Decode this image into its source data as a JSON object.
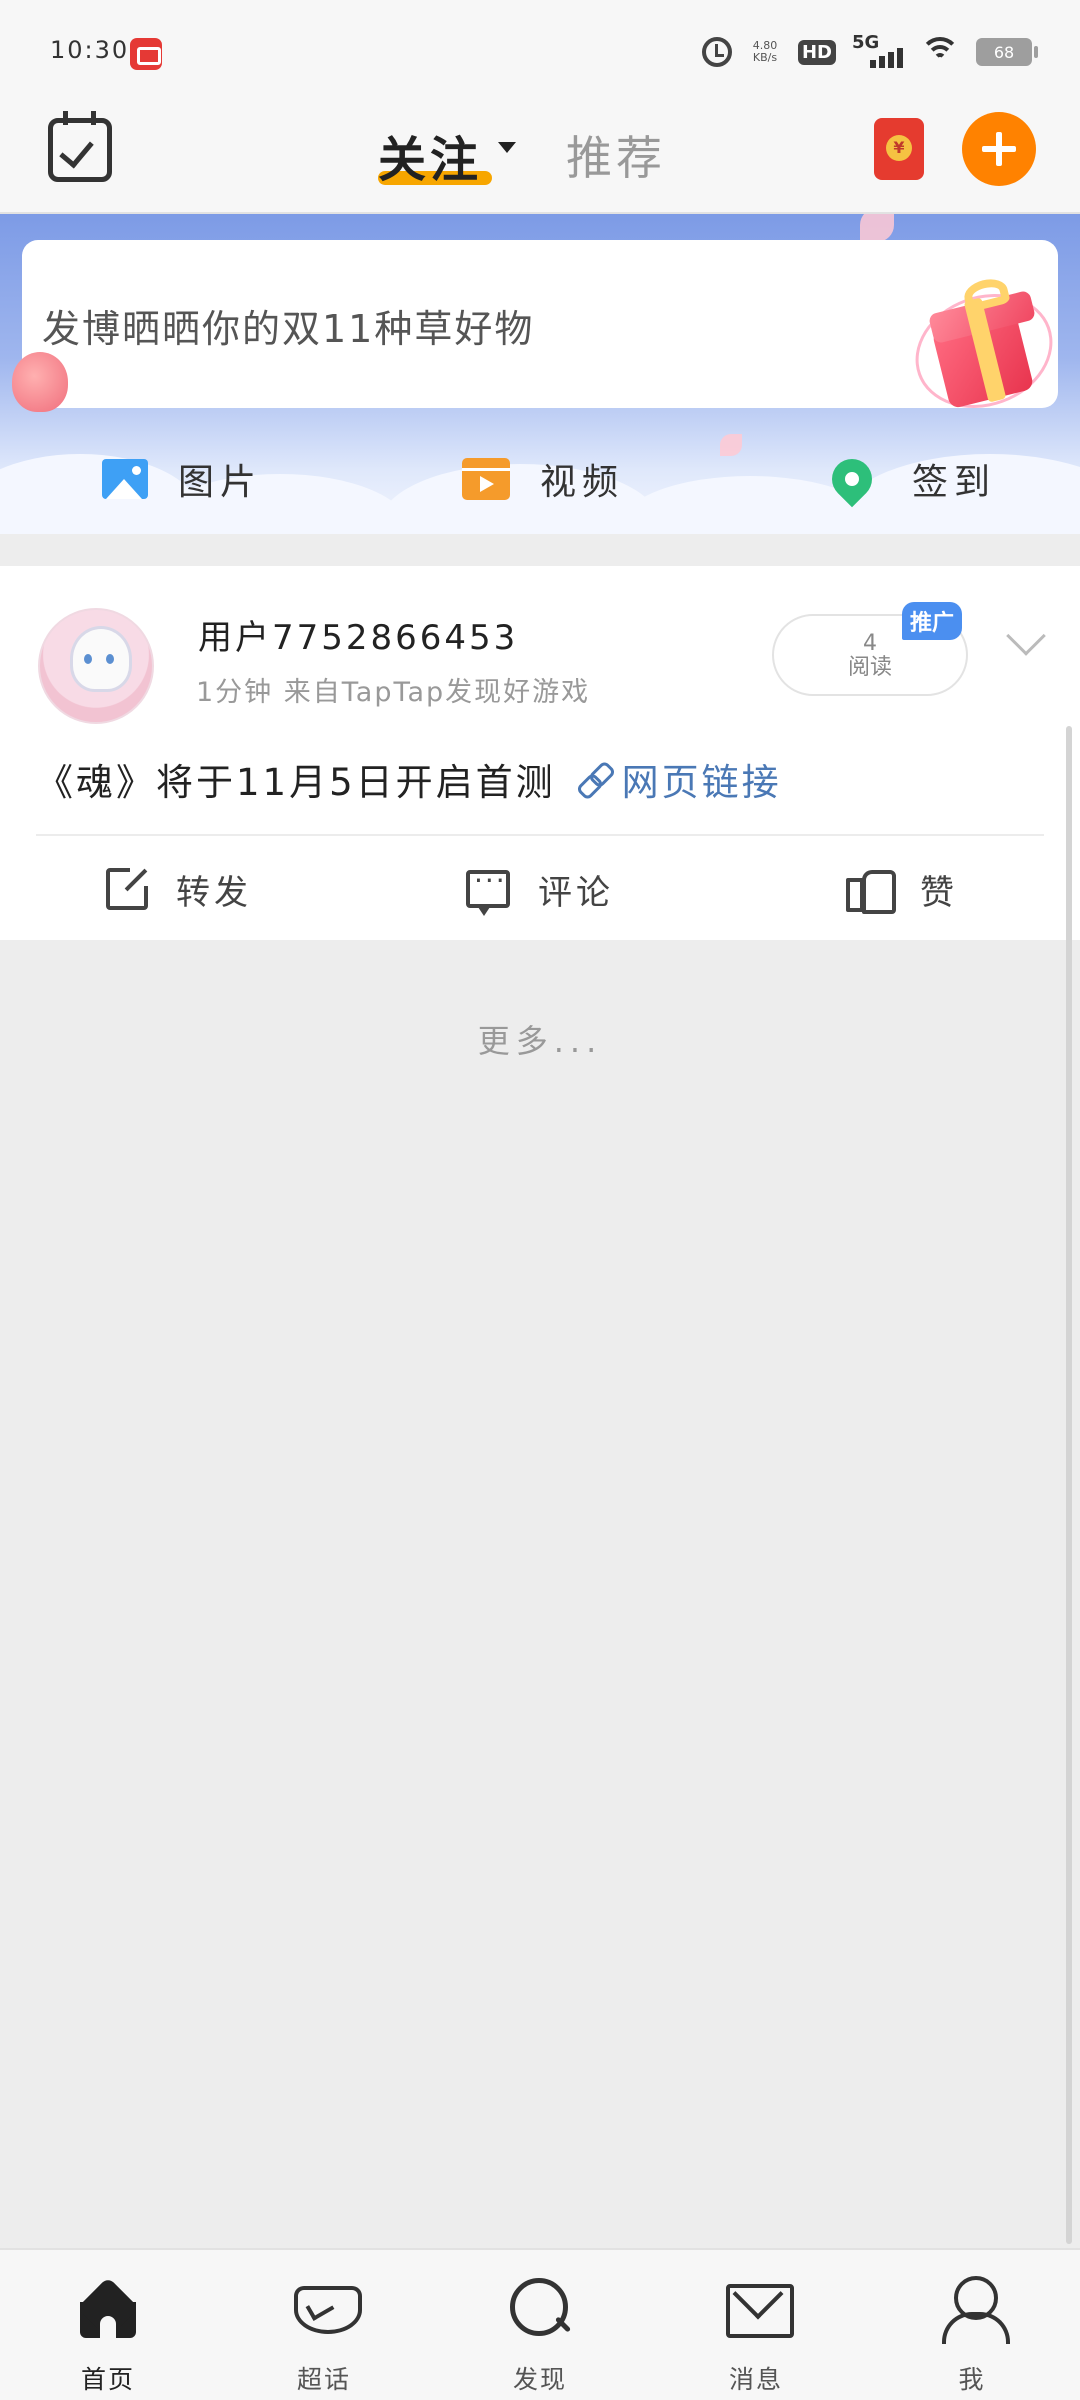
{
  "status_bar": {
    "time": "10:30",
    "net_speed_value": "4.80",
    "net_speed_unit": "KB/s",
    "hd_label": "HD",
    "network_label": "5G",
    "battery": "68"
  },
  "top_nav": {
    "tabs": [
      {
        "label": "关注",
        "active": true
      },
      {
        "label": "推荐",
        "active": false
      }
    ],
    "accent_color": "#f7a600",
    "add_button_color": "#ff8200"
  },
  "compose": {
    "placeholder": "发博晒晒你的双11种草好物",
    "actions": [
      {
        "label": "图片",
        "icon": "image-icon"
      },
      {
        "label": "视频",
        "icon": "video-icon"
      },
      {
        "label": "签到",
        "icon": "location-pin-icon"
      }
    ]
  },
  "feed": {
    "posts": [
      {
        "username": "用户7752866453",
        "meta": "1分钟  来自TapTap发现好游戏",
        "reads_count": "4",
        "reads_label": "阅读",
        "promo_badge": "推广",
        "text": "《魂》将于11月5日开启首测",
        "link_label": "网页链接",
        "actions": [
          {
            "label": "转发",
            "icon": "share-icon"
          },
          {
            "label": "评论",
            "icon": "comment-icon"
          },
          {
            "label": "赞",
            "icon": "like-icon"
          }
        ]
      }
    ],
    "more_label": "更多..."
  },
  "bottom_nav": {
    "items": [
      {
        "label": "首页",
        "icon": "home-icon",
        "active": true
      },
      {
        "label": "超话",
        "icon": "topic-icon",
        "active": false
      },
      {
        "label": "发现",
        "icon": "search-icon",
        "active": false
      },
      {
        "label": "消息",
        "icon": "mail-icon",
        "active": false
      },
      {
        "label": "我",
        "icon": "profile-icon",
        "active": false
      }
    ]
  }
}
